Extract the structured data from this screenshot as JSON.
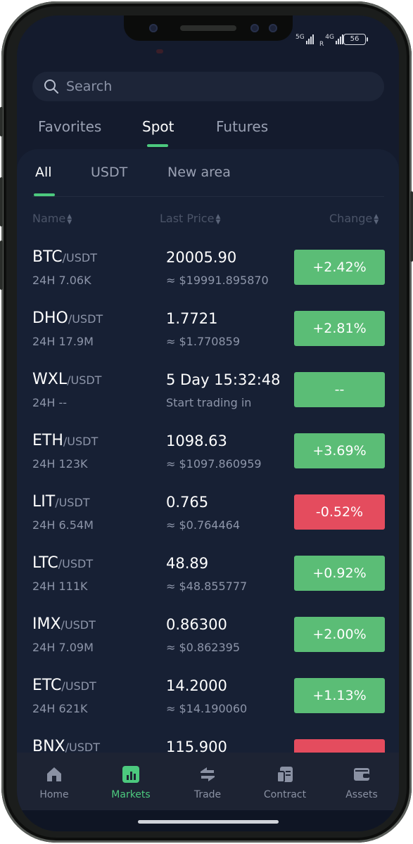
{
  "status": {
    "signal1": "5G",
    "signal2": "4G",
    "roaming": "R",
    "battery": "56"
  },
  "search": {
    "placeholder": "Search"
  },
  "top_tabs": [
    "Favorites",
    "Spot",
    "Futures"
  ],
  "sub_tabs": [
    "All",
    "USDT",
    "New area"
  ],
  "columns": {
    "name": "Name",
    "last_price": "Last Price",
    "change": "Change"
  },
  "rows": [
    {
      "base": "BTC",
      "quote": "/USDT",
      "vol": "24H 7.06K",
      "price": "20005.90",
      "fiat": "≈ $19991.895870",
      "change": "+2.42%",
      "direction": "up"
    },
    {
      "base": "DHO",
      "quote": "/USDT",
      "vol": "24H 17.9M",
      "price": "1.7721",
      "fiat": "≈ $1.770859",
      "change": "+2.81%",
      "direction": "up"
    },
    {
      "base": "WXL",
      "quote": "/USDT",
      "vol": "24H --",
      "price": "5 Day 15:32:48",
      "fiat": "Start trading in",
      "change": "--",
      "direction": "up"
    },
    {
      "base": "ETH",
      "quote": "/USDT",
      "vol": "24H 123K",
      "price": "1098.63",
      "fiat": "≈ $1097.860959",
      "change": "+3.69%",
      "direction": "up"
    },
    {
      "base": "LIT",
      "quote": "/USDT",
      "vol": "24H 6.54M",
      "price": "0.765",
      "fiat": "≈ $0.764464",
      "change": "-0.52%",
      "direction": "down"
    },
    {
      "base": "LTC",
      "quote": "/USDT",
      "vol": "24H 111K",
      "price": "48.89",
      "fiat": "≈ $48.855777",
      "change": "+0.92%",
      "direction": "up"
    },
    {
      "base": "IMX",
      "quote": "/USDT",
      "vol": "24H 7.09M",
      "price": "0.86300",
      "fiat": "≈ $0.862395",
      "change": "+2.00%",
      "direction": "up"
    },
    {
      "base": "ETC",
      "quote": "/USDT",
      "vol": "24H 621K",
      "price": "14.2000",
      "fiat": "≈ $14.190060",
      "change": "+1.13%",
      "direction": "up"
    },
    {
      "base": "BNX",
      "quote": "/USDT",
      "vol": "",
      "price": "115.900",
      "fiat": "",
      "change": "",
      "direction": "down"
    }
  ],
  "nav": [
    {
      "label": "Home",
      "icon": "home-icon"
    },
    {
      "label": "Markets",
      "icon": "markets-icon"
    },
    {
      "label": "Trade",
      "icon": "trade-icon"
    },
    {
      "label": "Contract",
      "icon": "contract-icon"
    },
    {
      "label": "Assets",
      "icon": "assets-icon"
    }
  ],
  "colors": {
    "accent": "#4cc97e",
    "up": "#5bbd76",
    "down": "#e44c5e",
    "background": "#141b2d"
  }
}
